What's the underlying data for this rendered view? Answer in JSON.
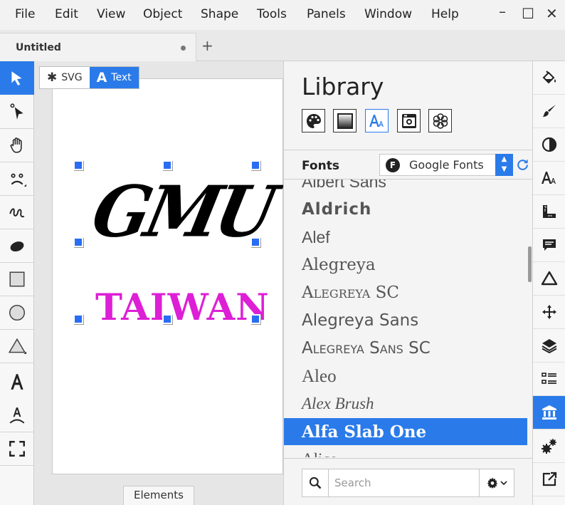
{
  "menubar": {
    "items": [
      "File",
      "Edit",
      "View",
      "Object",
      "Shape",
      "Tools",
      "Panels",
      "Window",
      "Help"
    ],
    "window_controls": [
      "–",
      "☐",
      "✕"
    ]
  },
  "tabs": {
    "document_title": "Untitled",
    "add_tab": "+"
  },
  "canvas": {
    "mode_svg_label": "SVG",
    "mode_text_label": "Text",
    "active_mode": "Text",
    "text_line1": "GMU",
    "text_line2": "TAIWAN",
    "text_line2_color": "#dd1fd6",
    "elements_tab_label": "Elements"
  },
  "library": {
    "title": "Library",
    "categories": [
      "palette-icon",
      "gradient-icon",
      "fonts-icon",
      "image-icon",
      "pattern-icon"
    ],
    "active_category": "fonts-icon",
    "fonts_label": "Fonts",
    "font_source": "Google Fonts",
    "fonts": [
      "Albert Sans",
      "Aldrich",
      "Alef",
      "Alegreya",
      "Alegreya SC",
      "Alegreya Sans",
      "Alegreya Sans SC",
      "Aleo",
      "Alex Brush",
      "Alfa Slab One",
      "Alice"
    ],
    "selected_font": "Alfa Slab One",
    "search_placeholder": "Search"
  },
  "colors": {
    "accent": "#2a7be9",
    "handle": "#2a6df4"
  }
}
